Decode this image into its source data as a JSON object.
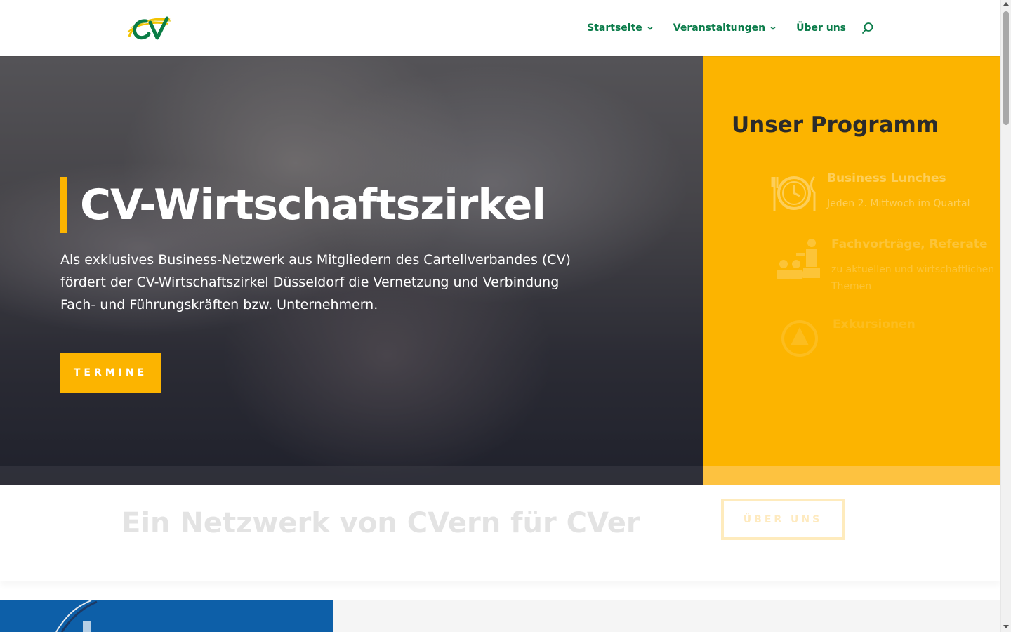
{
  "header": {
    "logo_text": "CV",
    "nav": [
      {
        "label": "Startseite",
        "has_dropdown": true
      },
      {
        "label": "Veranstaltungen",
        "has_dropdown": true
      },
      {
        "label": "Über uns",
        "has_dropdown": false
      }
    ],
    "search_icon": "search-icon"
  },
  "hero": {
    "title": "CV-Wirtschaftszirkel",
    "text": "Als exklusives Business-Netzwerk aus Mitgliedern des Cartellverbandes (CV) fördert der CV-Wirtschaftszirkel Düsseldorf die Vernetzung und Verbindung Fach- und Führungskräften bzw. Unternehmern.",
    "button": "TERMINE"
  },
  "program": {
    "title": "Unser Programm",
    "items": [
      {
        "name": "Business Lunches",
        "desc": "Jeden 2. Mittwoch im Quartal",
        "icon": "lunch-clock-icon"
      },
      {
        "name": "Fachvorträge, Referate",
        "desc": "zu aktuellen und wirtschaftlichen\nThemen",
        "icon": "presentation-icon"
      },
      {
        "name": "Exkursionen",
        "desc": "",
        "icon": "excursion-icon"
      }
    ]
  },
  "network": {
    "title": "Ein Netzwerk von CVern für CVer",
    "button": "ÜBER UNS"
  },
  "colors": {
    "accent": "#fcb400",
    "nav_green": "#0b7c4a",
    "dark_text": "#2b2b2b"
  }
}
